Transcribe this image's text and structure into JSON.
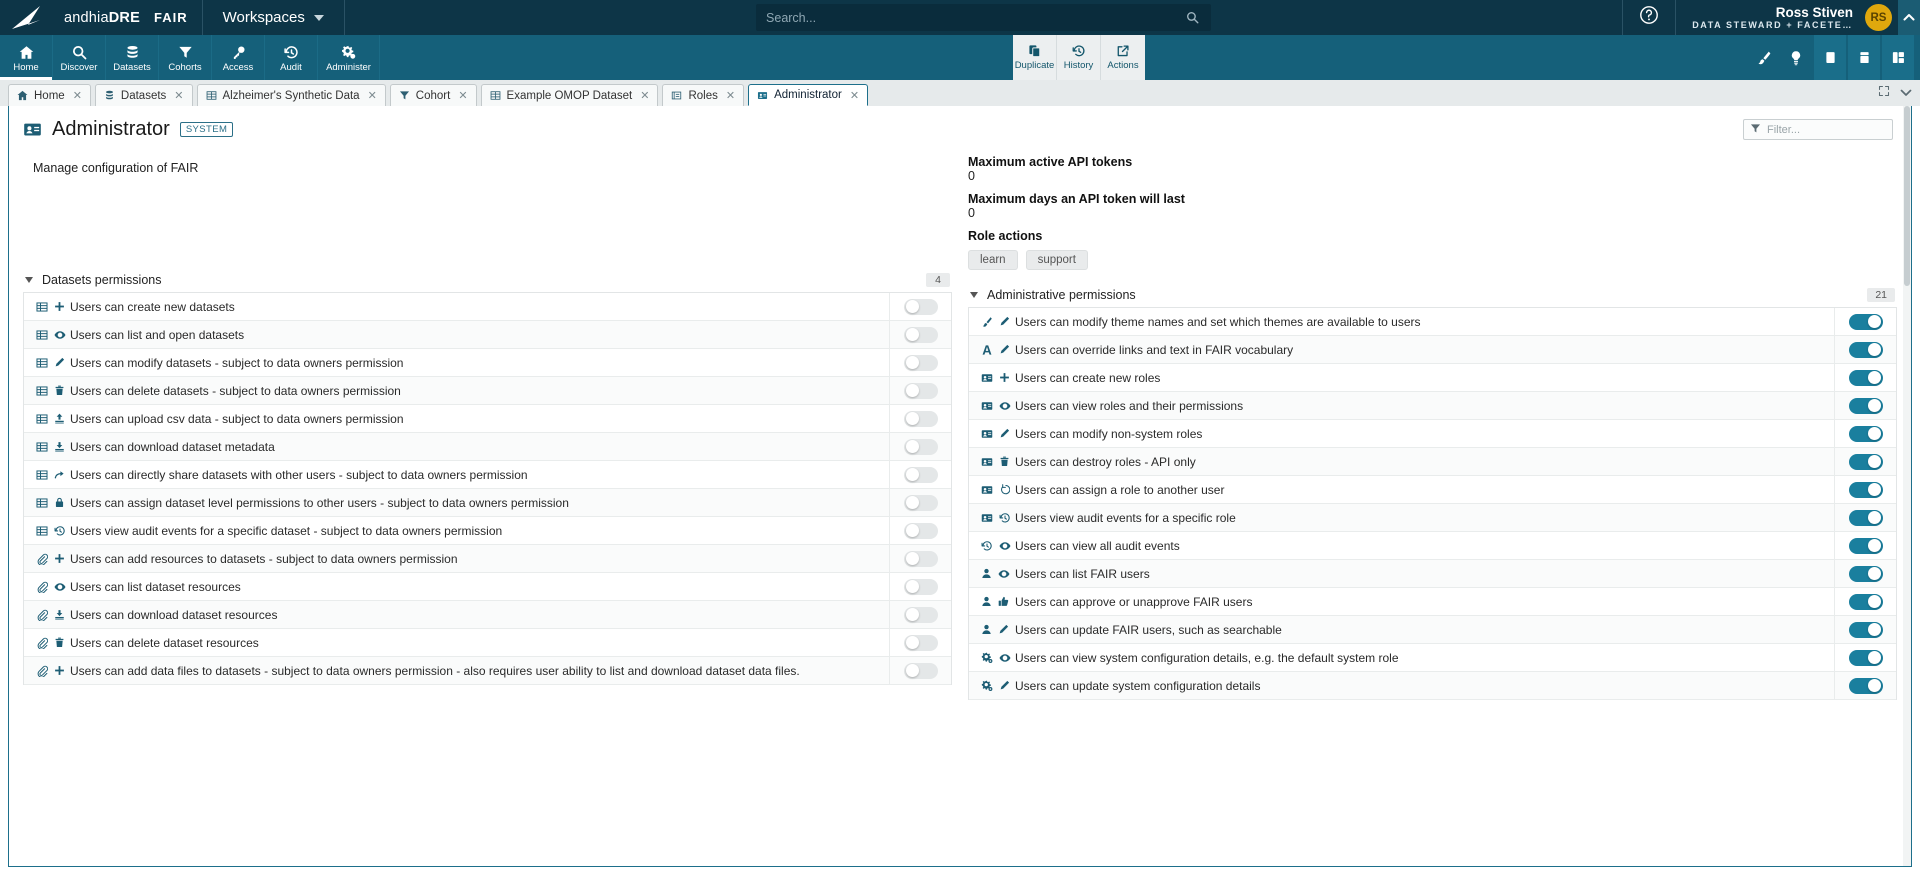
{
  "topbar": {
    "logo_word_1": "andhia",
    "logo_word_2": "DRE",
    "logo_fair": "FAIR",
    "workspaces_label": "Workspaces",
    "search_placeholder": "Search...",
    "help_icon": "question-circle-icon",
    "user_name": "Ross Stiven",
    "user_role": "DATA STEWARD + FACETE…",
    "user_initials": "RS",
    "collapse_icon": "chevron-up-icon"
  },
  "nav": {
    "items": [
      {
        "label": "Home",
        "icon": "home-icon",
        "active": true
      },
      {
        "label": "Discover",
        "icon": "search-icon",
        "active": false
      },
      {
        "label": "Datasets",
        "icon": "database-icon",
        "active": false
      },
      {
        "label": "Cohorts",
        "icon": "filter-icon",
        "active": false
      },
      {
        "label": "Access",
        "icon": "key-icon",
        "active": false
      },
      {
        "label": "Audit",
        "icon": "history-icon",
        "active": false
      },
      {
        "label": "Administer",
        "icon": "gears-icon",
        "active": false
      }
    ],
    "tools": [
      {
        "label": "Duplicate",
        "icon": "duplicate-icon"
      },
      {
        "label": "History",
        "icon": "history-icon"
      },
      {
        "label": "Actions",
        "icon": "external-link-icon"
      }
    ],
    "right_icons": [
      "brush-icon",
      "lightbulb-icon",
      "panel-single-icon",
      "panel-stacked-icon",
      "panel-split-icon"
    ]
  },
  "tabs": [
    {
      "label": "Home",
      "icon": "home-icon",
      "active": false
    },
    {
      "label": "Datasets",
      "icon": "database-icon",
      "active": false
    },
    {
      "label": "Alzheimer's Synthetic Data",
      "icon": "table-icon",
      "active": false
    },
    {
      "label": "Cohort",
      "icon": "filter-icon",
      "active": false
    },
    {
      "label": "Example OMOP Dataset",
      "icon": "table-icon",
      "active": false
    },
    {
      "label": "Roles",
      "icon": "id-card-icon",
      "active": false
    },
    {
      "label": "Administrator",
      "icon": "id-card-icon",
      "active": true
    }
  ],
  "tabstrip_right_icons": [
    "expand-icon",
    "chevron-down-icon"
  ],
  "page": {
    "title": "Administrator",
    "badge": "SYSTEM",
    "icon": "id-card-icon",
    "filter_placeholder": "Filter...",
    "filter_value": "",
    "filter_icon": "filter-icon",
    "description": "Manage configuration of FAIR"
  },
  "details": {
    "max_tokens_label": "Maximum active API tokens",
    "max_tokens_value": "0",
    "max_days_label": "Maximum days an API token will last",
    "max_days_value": "0",
    "role_actions_label": "Role actions",
    "role_actions": [
      "learn",
      "support"
    ]
  },
  "datasets_section": {
    "title": "Datasets permissions",
    "count": "4",
    "rows": [
      {
        "icons": [
          "table-icon",
          "plus-icon"
        ],
        "label": "Users can create new datasets",
        "on": false
      },
      {
        "icons": [
          "table-icon",
          "eye-icon"
        ],
        "label": "Users can list and open datasets",
        "on": false
      },
      {
        "icons": [
          "table-icon",
          "pencil-icon"
        ],
        "label": "Users can modify datasets - subject to data owners permission",
        "on": false
      },
      {
        "icons": [
          "table-icon",
          "trash-icon"
        ],
        "label": "Users can delete datasets - subject to data owners permission",
        "on": false
      },
      {
        "icons": [
          "table-icon",
          "upload-icon"
        ],
        "label": "Users can upload csv data - subject to data owners permission",
        "on": false
      },
      {
        "icons": [
          "table-icon",
          "download-icon"
        ],
        "label": "Users can download dataset metadata",
        "on": false
      },
      {
        "icons": [
          "table-icon",
          "share-icon"
        ],
        "label": "Users can directly share datasets with other users - subject to data owners permission",
        "on": false
      },
      {
        "icons": [
          "table-icon",
          "lock-icon"
        ],
        "label": "Users can assign dataset level permissions to other users - subject to data owners permission",
        "on": false
      },
      {
        "icons": [
          "table-icon",
          "history-icon"
        ],
        "label": "Users view audit events for a specific dataset - subject to data owners permission",
        "on": false
      },
      {
        "icons": [
          "paperclip-icon",
          "plus-icon"
        ],
        "label": "Users can add resources to datasets - subject to data owners permission",
        "on": false
      },
      {
        "icons": [
          "paperclip-icon",
          "eye-icon"
        ],
        "label": "Users can list dataset resources",
        "on": false
      },
      {
        "icons": [
          "paperclip-icon",
          "download-icon"
        ],
        "label": "Users can download dataset resources",
        "on": false
      },
      {
        "icons": [
          "paperclip-icon",
          "trash-icon"
        ],
        "label": "Users can delete dataset resources",
        "on": false
      },
      {
        "icons": [
          "paperclip-icon",
          "plus-icon"
        ],
        "label": "Users can add data files to datasets - subject to data owners permission - also requires user ability to list and download dataset data files.",
        "on": false
      }
    ]
  },
  "admin_section": {
    "title": "Administrative permissions",
    "count": "21",
    "rows": [
      {
        "icons": [
          "brush-icon",
          "pencil-icon"
        ],
        "label": "Users can modify theme names and set which themes are available to users",
        "on": true
      },
      {
        "icons": [
          "font-icon",
          "pencil-icon"
        ],
        "label": "Users can override links and text in FAIR vocabulary",
        "on": true
      },
      {
        "icons": [
          "id-card-icon",
          "plus-icon"
        ],
        "label": "Users can create new roles",
        "on": true
      },
      {
        "icons": [
          "id-card-icon",
          "eye-icon"
        ],
        "label": "Users can view roles and their permissions",
        "on": true
      },
      {
        "icons": [
          "id-card-icon",
          "pencil-icon"
        ],
        "label": "Users can modify non-system roles",
        "on": true
      },
      {
        "icons": [
          "id-card-icon",
          "trash-icon"
        ],
        "label": "Users can destroy roles - API only",
        "on": true
      },
      {
        "icons": [
          "id-card-icon",
          "assign-icon"
        ],
        "label": "Users can assign a role to another user",
        "on": true
      },
      {
        "icons": [
          "id-card-icon",
          "history-icon"
        ],
        "label": "Users view audit events for a specific role",
        "on": true
      },
      {
        "icons": [
          "history-icon",
          "eye-icon"
        ],
        "label": "Users can view all audit events",
        "on": true
      },
      {
        "icons": [
          "user-icon",
          "eye-icon"
        ],
        "label": "Users can list FAIR users",
        "on": true
      },
      {
        "icons": [
          "user-icon",
          "thumbs-up-icon"
        ],
        "label": "Users can approve or unapprove FAIR users",
        "on": true
      },
      {
        "icons": [
          "user-icon",
          "pencil-icon"
        ],
        "label": "Users can update FAIR users, such as searchable",
        "on": true
      },
      {
        "icons": [
          "gears-icon",
          "eye-icon"
        ],
        "label": "Users can view system configuration details, e.g. the default system role",
        "on": true
      },
      {
        "icons": [
          "gears-icon",
          "pencil-icon"
        ],
        "label": "Users can update system configuration details",
        "on": true
      }
    ]
  }
}
